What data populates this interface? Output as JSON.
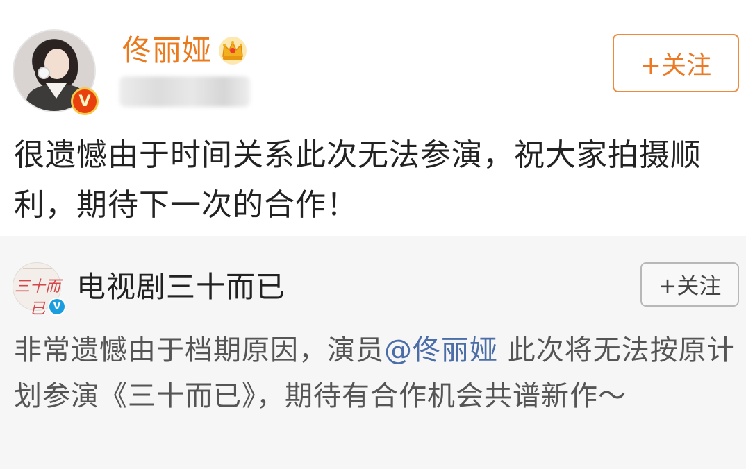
{
  "post": {
    "author": {
      "name": "佟丽娅",
      "verified_badge": "V",
      "icons": [
        "avatar-photo",
        "crown-icon",
        "verified-v-icon"
      ]
    },
    "follow_label": "+关注",
    "text": "很遗憾由于时间关系此次无法参演，祝大家拍摄顺利，期待下一次的合作！"
  },
  "repost": {
    "author": {
      "name": "电视剧三十而已",
      "avatar_text": "三十而已",
      "verified_badge": "V"
    },
    "follow_label": "+关注",
    "text_before": "非常遗憾由于档期原因，演员",
    "mention": "@佟丽娅",
    "text_after": " 此次将无法按原计划参演《三十而已》，期待有合作机会共谱新作～"
  },
  "colors": {
    "username": "#ea7a1e",
    "follow_accent": "#ee8a3b",
    "mention_link": "#4b6ea8",
    "repost_bg": "#f6f6f6",
    "verified_red": "#e8410e",
    "verified_blue": "#1a9ee0"
  }
}
